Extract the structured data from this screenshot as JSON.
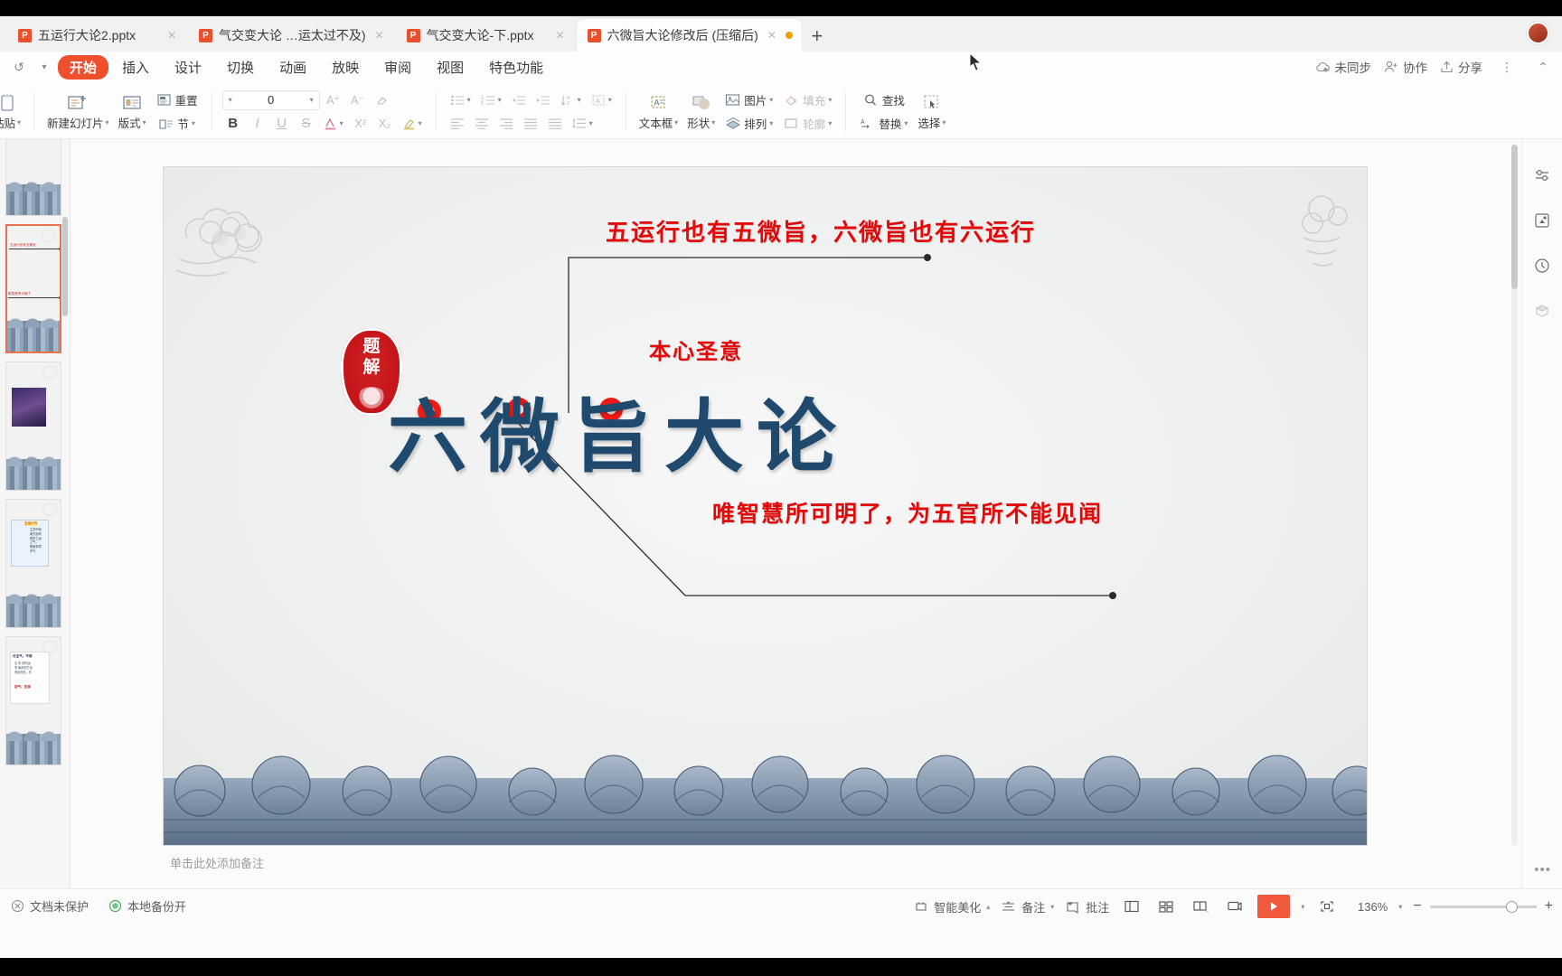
{
  "window": {
    "tabs": [
      {
        "label": "五运行大论2.pptx",
        "active": false,
        "modified": false
      },
      {
        "label": "气交变大论 …运太过不及)",
        "active": false,
        "modified": false
      },
      {
        "label": "气交变大论-下.pptx",
        "active": false,
        "modified": false
      },
      {
        "label": "六微旨大论修改后 (压缩后)",
        "active": true,
        "modified": true
      }
    ],
    "new_tab_label": "+"
  },
  "menu": {
    "items": [
      {
        "label": "开始",
        "active": true
      },
      {
        "label": "插入",
        "active": false
      },
      {
        "label": "设计",
        "active": false
      },
      {
        "label": "切换",
        "active": false
      },
      {
        "label": "动画",
        "active": false
      },
      {
        "label": "放映",
        "active": false
      },
      {
        "label": "审阅",
        "active": false
      },
      {
        "label": "视图",
        "active": false
      },
      {
        "label": "特色功能",
        "active": false
      }
    ],
    "right": {
      "sync": "未同步",
      "collab": "协作",
      "share": "分享"
    }
  },
  "ribbon": {
    "paste": "粘贴",
    "new_slide": "新建幻灯片",
    "layout": "版式",
    "reset": "重置",
    "section": "节",
    "font_size": "0",
    "bold": "B",
    "italic": "I",
    "underline": "U",
    "strike": "S",
    "textbox": "文本框",
    "shape": "形状",
    "picture": "图片",
    "arrange": "排列",
    "fill": "填充",
    "outline": "轮廓",
    "find": "查找",
    "replace": "替换",
    "select": "选择"
  },
  "slide": {
    "title": "六微旨大论",
    "seal_line1": "题",
    "seal_line2": "解",
    "annotations": [
      {
        "id": "top",
        "text": "五运行也有五微旨，六微旨也有六运行"
      },
      {
        "id": "middle",
        "text": "本心圣意"
      },
      {
        "id": "bottom",
        "text": "唯智慧所可明了，为五官所不能见闻"
      }
    ]
  },
  "notes": {
    "placeholder": "单击此处添加备注"
  },
  "status": {
    "protection": "文档未保护",
    "backup": "本地备份开",
    "beautify": "智能美化",
    "note": "备注",
    "comment": "批注",
    "zoom": "136%"
  },
  "colors": {
    "accent": "#ee4f2c",
    "title_blue": "#20496e",
    "annotation_red": "#e1090a",
    "seal_red": "#c5161b",
    "play_red": "#f1593c"
  },
  "thumbnails": [
    {
      "index": 1,
      "selected": false
    },
    {
      "index": 2,
      "selected": true
    },
    {
      "index": 3,
      "selected": false
    },
    {
      "index": 4,
      "selected": false
    },
    {
      "index": 5,
      "selected": false
    }
  ]
}
